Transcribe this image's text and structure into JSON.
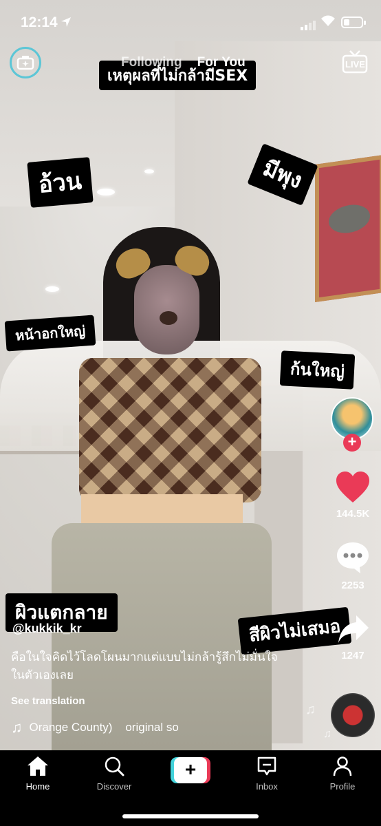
{
  "status_bar": {
    "time": "12:14"
  },
  "feed_tabs": {
    "following": "Following",
    "for_you": "For You"
  },
  "top_right": {
    "live_label": "LIVE"
  },
  "stickers": {
    "title": "เหตุผลที่ไม่กล้ามีSEX",
    "s1": "อ้วน",
    "s2": "มีพุง",
    "s3": "หน้าอกใหญ่",
    "s4": "ก้นใหญ่",
    "s5": "ผิวแตกลาย",
    "s6": "สีผิวไม่เสมอ"
  },
  "rail": {
    "likes": "144.5K",
    "comments": "2253",
    "shares": "1247"
  },
  "post": {
    "username": "@kukkik_kr",
    "caption": "คือในใจคิดไว้โลดโผนมากแต่แบบไม่กล้ารู้สึกไม่มั่นใจในตัวเองเลย",
    "see_translation": "See translation",
    "sound": "Orange County)    original so"
  },
  "nav": {
    "home": "Home",
    "discover": "Discover",
    "create": "+",
    "inbox": "Inbox",
    "profile": "Profile"
  },
  "colors": {
    "accent_red": "#ea3a57",
    "accent_cyan": "#43d3db"
  }
}
